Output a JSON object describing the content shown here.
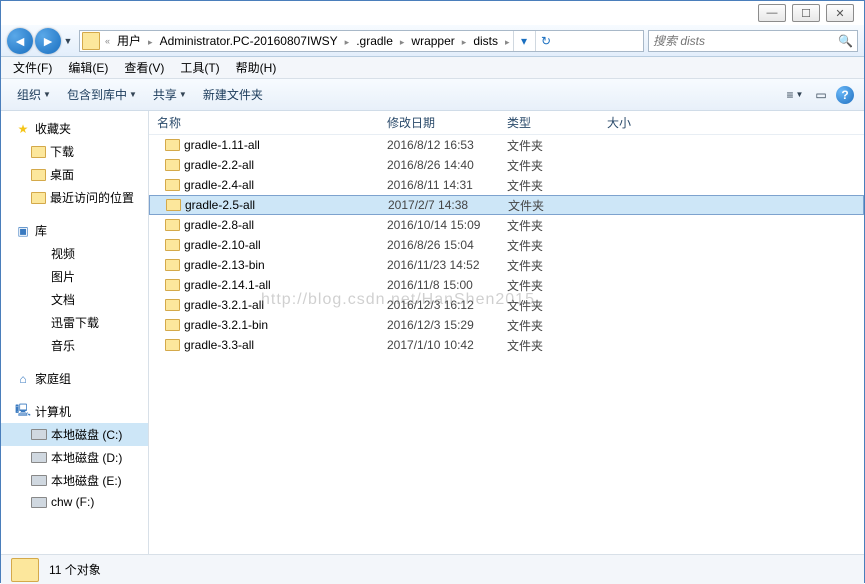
{
  "window_controls": {
    "min": "—",
    "max": "☐",
    "close": "✕"
  },
  "nav": {
    "back": "◄",
    "fwd": "►",
    "bc_prefix": "«",
    "breadcrumb": [
      "用户",
      "Administrator.PC-20160807IWSY",
      ".gradle",
      "wrapper",
      "dists"
    ],
    "refresh": "↻",
    "search_placeholder": "搜索 dists",
    "search_icon": "🔍"
  },
  "menu": [
    "文件(F)",
    "编辑(E)",
    "查看(V)",
    "工具(T)",
    "帮助(H)"
  ],
  "toolbar": {
    "organize": "组织",
    "include_lib": "包含到库中",
    "share": "共享",
    "new_folder": "新建文件夹",
    "view_icon": "≡",
    "preview_icon": "▭",
    "help": "?"
  },
  "tree": {
    "favorites": {
      "label": "收藏夹",
      "items": [
        "下载",
        "桌面",
        "最近访问的位置"
      ]
    },
    "libraries": {
      "label": "库",
      "items": [
        "视频",
        "图片",
        "文档",
        "迅雷下载",
        "音乐"
      ]
    },
    "homegroup": {
      "label": "家庭组"
    },
    "computer": {
      "label": "计算机",
      "items": [
        "本地磁盘 (C:)",
        "本地磁盘 (D:)",
        "本地磁盘 (E:)",
        "chw (F:)"
      ],
      "selected": 0
    }
  },
  "columns": {
    "name": "名称",
    "date": "修改日期",
    "type": "类型",
    "size": "大小"
  },
  "files": [
    {
      "name": "gradle-1.11-all",
      "date": "2016/8/12 16:53",
      "type": "文件夹"
    },
    {
      "name": "gradle-2.2-all",
      "date": "2016/8/26 14:40",
      "type": "文件夹"
    },
    {
      "name": "gradle-2.4-all",
      "date": "2016/8/11 14:31",
      "type": "文件夹"
    },
    {
      "name": "gradle-2.5-all",
      "date": "2017/2/7 14:38",
      "type": "文件夹",
      "selected": true
    },
    {
      "name": "gradle-2.8-all",
      "date": "2016/10/14 15:09",
      "type": "文件夹"
    },
    {
      "name": "gradle-2.10-all",
      "date": "2016/8/26 15:04",
      "type": "文件夹"
    },
    {
      "name": "gradle-2.13-bin",
      "date": "2016/11/23 14:52",
      "type": "文件夹"
    },
    {
      "name": "gradle-2.14.1-all",
      "date": "2016/11/8 15:00",
      "type": "文件夹"
    },
    {
      "name": "gradle-3.2.1-all",
      "date": "2016/12/3 16:12",
      "type": "文件夹"
    },
    {
      "name": "gradle-3.2.1-bin",
      "date": "2016/12/3 15:29",
      "type": "文件夹"
    },
    {
      "name": "gradle-3.3-all",
      "date": "2017/1/10 10:42",
      "type": "文件夹"
    }
  ],
  "status": {
    "count": "11 个对象"
  },
  "watermark": "http://blog.csdn.net/HanShen2015"
}
